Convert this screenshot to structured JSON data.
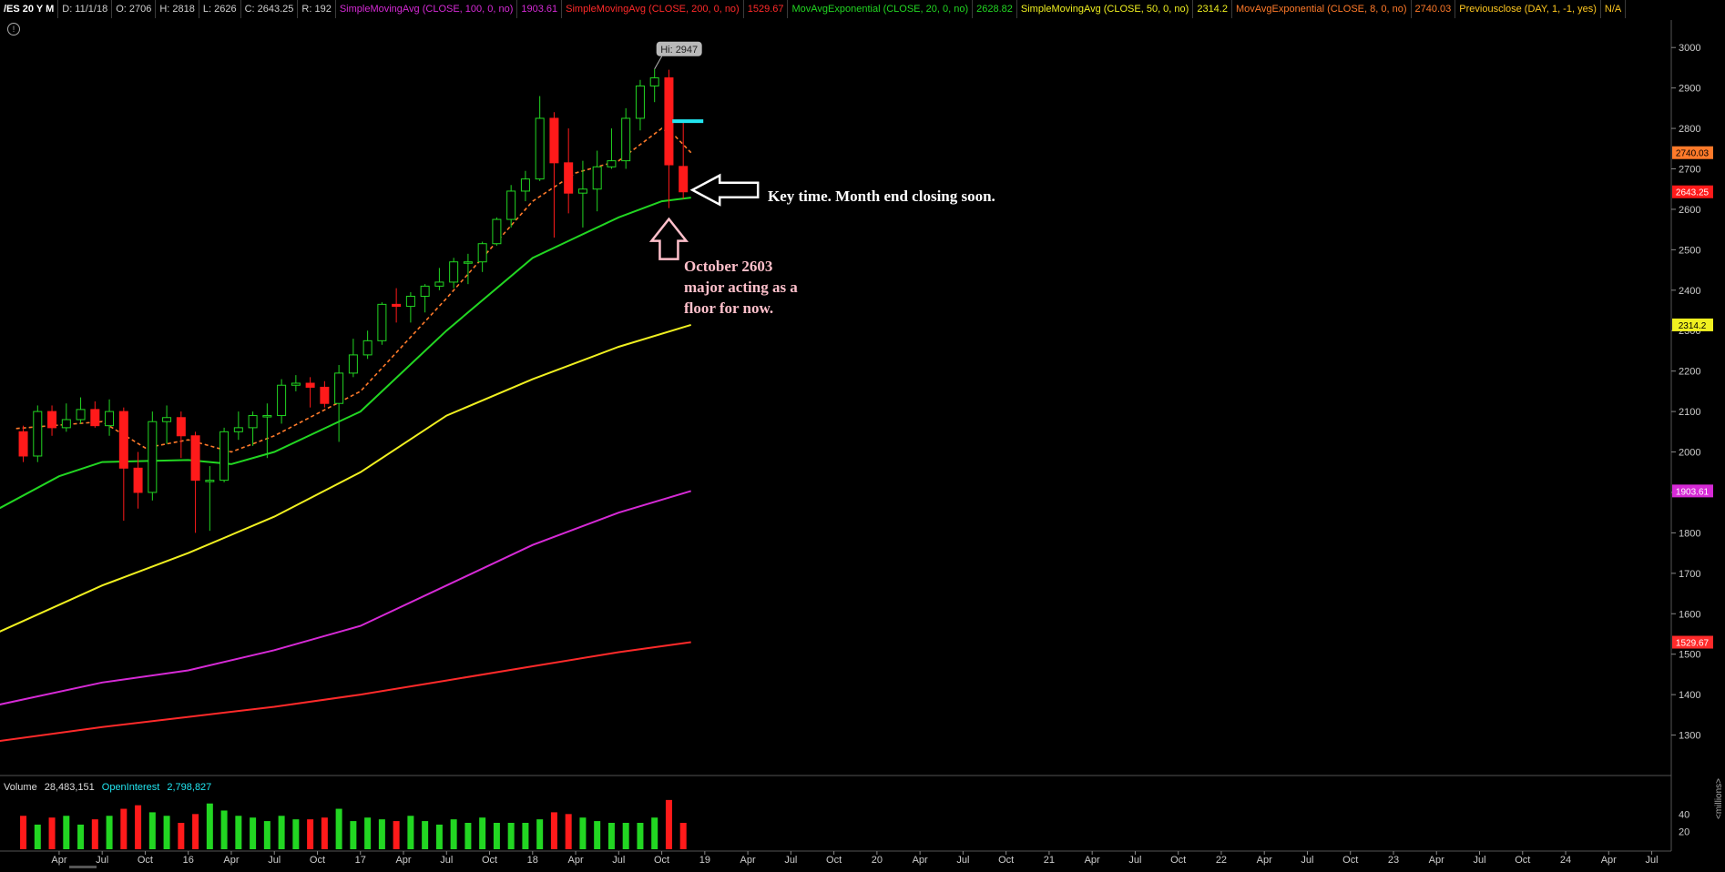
{
  "header": {
    "symbol": "/ES 20 Y M",
    "date": "D: 11/1/18",
    "open": "O: 2706",
    "high": "H: 2818",
    "low": "L: 2626",
    "close": "C: 2643.25",
    "range": "R: 192",
    "studies": [
      {
        "label": "SimpleMovingAvg (CLOSE, 100, 0, no)",
        "value": "1903.61",
        "color": "#d62ad6"
      },
      {
        "label": "SimpleMovingAvg (CLOSE, 200, 0, no)",
        "value": "1529.67",
        "color": "#ff2a2a"
      },
      {
        "label": "MovAvgExponential (CLOSE, 20, 0, no)",
        "value": "2628.82",
        "color": "#22d622"
      },
      {
        "label": "SimpleMovingAvg (CLOSE, 50, 0, no)",
        "value": "2314.2",
        "color": "#f0f020"
      },
      {
        "label": "MovAvgExponential (CLOSE, 8, 0, no)",
        "value": "2740.03",
        "color": "#ff7a2a"
      },
      {
        "label": "Previousclose (DAY, 1, -1, yes)",
        "value": "N/A",
        "color": "#ffc820"
      }
    ]
  },
  "info_icon": "!",
  "volume_header": {
    "volume_label": "Volume",
    "volume_value": "28,483,151",
    "oi_label": "OpenInterest",
    "oi_value": "2,798,827"
  },
  "volume_unit": "<millions>",
  "annotations": {
    "note1": "Key time. Month end closing soon.",
    "note2": "October 2603\nmajor acting as a\nfloor for now."
  },
  "colors": {
    "up": "#22d622",
    "down": "#ff1a1a",
    "background": "#000000",
    "grid": "#2a2a2a",
    "ema8": "#ff7a2a",
    "ema20": "#22d622",
    "sma50": "#f0f020",
    "sma100": "#d62ad6",
    "sma200": "#ff2a2a",
    "cyan_marker": "#22e5f0"
  },
  "chart_data": {
    "type": "candlestick",
    "ylim": [
      1200,
      3050
    ],
    "y_ticks": [
      1300,
      1400,
      1500,
      1600,
      1700,
      1800,
      1900,
      2000,
      2100,
      2200,
      2300,
      2400,
      2500,
      2600,
      2700,
      2800,
      2900,
      3000
    ],
    "x_range": [
      "2014-12",
      "2024-07"
    ],
    "x_ticks": [
      {
        "date": "2015-04",
        "label": "Apr"
      },
      {
        "date": "2015-07",
        "label": "Jul"
      },
      {
        "date": "2015-10",
        "label": "Oct"
      },
      {
        "date": "2016-01",
        "label": "16"
      },
      {
        "date": "2016-04",
        "label": "Apr"
      },
      {
        "date": "2016-07",
        "label": "Jul"
      },
      {
        "date": "2016-10",
        "label": "Oct"
      },
      {
        "date": "2017-01",
        "label": "17"
      },
      {
        "date": "2017-04",
        "label": "Apr"
      },
      {
        "date": "2017-07",
        "label": "Jul"
      },
      {
        "date": "2017-10",
        "label": "Oct"
      },
      {
        "date": "2018-01",
        "label": "18"
      },
      {
        "date": "2018-04",
        "label": "Apr"
      },
      {
        "date": "2018-07",
        "label": "Jul"
      },
      {
        "date": "2018-10",
        "label": "Oct"
      },
      {
        "date": "2019-01",
        "label": "19"
      },
      {
        "date": "2019-04",
        "label": "Apr"
      },
      {
        "date": "2019-07",
        "label": "Jul"
      },
      {
        "date": "2019-10",
        "label": "Oct"
      },
      {
        "date": "2020-01",
        "label": "20"
      },
      {
        "date": "2020-04",
        "label": "Apr"
      },
      {
        "date": "2020-07",
        "label": "Jul"
      },
      {
        "date": "2020-10",
        "label": "Oct"
      },
      {
        "date": "2021-01",
        "label": "21"
      },
      {
        "date": "2021-04",
        "label": "Apr"
      },
      {
        "date": "2021-07",
        "label": "Jul"
      },
      {
        "date": "2021-10",
        "label": "Oct"
      },
      {
        "date": "2022-01",
        "label": "22"
      },
      {
        "date": "2022-04",
        "label": "Apr"
      },
      {
        "date": "2022-07",
        "label": "Jul"
      },
      {
        "date": "2022-10",
        "label": "Oct"
      },
      {
        "date": "2023-01",
        "label": "23"
      },
      {
        "date": "2023-04",
        "label": "Apr"
      },
      {
        "date": "2023-07",
        "label": "Jul"
      },
      {
        "date": "2023-10",
        "label": "Oct"
      },
      {
        "date": "2024-01",
        "label": "24"
      },
      {
        "date": "2024-04",
        "label": "Apr"
      },
      {
        "date": "2024-07",
        "label": "Jul"
      }
    ],
    "candles": [
      {
        "date": "2015-01",
        "o": 2050,
        "h": 2065,
        "l": 1975,
        "c": 1990
      },
      {
        "date": "2015-02",
        "o": 1990,
        "h": 2115,
        "l": 1975,
        "c": 2100
      },
      {
        "date": "2015-03",
        "o": 2100,
        "h": 2115,
        "l": 2040,
        "c": 2060
      },
      {
        "date": "2015-04",
        "o": 2060,
        "h": 2120,
        "l": 2050,
        "c": 2080
      },
      {
        "date": "2015-05",
        "o": 2080,
        "h": 2135,
        "l": 2070,
        "c": 2105
      },
      {
        "date": "2015-06",
        "o": 2105,
        "h": 2125,
        "l": 2060,
        "c": 2065
      },
      {
        "date": "2015-07",
        "o": 2065,
        "h": 2130,
        "l": 2040,
        "c": 2100
      },
      {
        "date": "2015-08",
        "o": 2100,
        "h": 2110,
        "l": 1830,
        "c": 1960
      },
      {
        "date": "2015-09",
        "o": 1960,
        "h": 2000,
        "l": 1860,
        "c": 1900
      },
      {
        "date": "2015-10",
        "o": 1900,
        "h": 2100,
        "l": 1880,
        "c": 2075
      },
      {
        "date": "2015-11",
        "o": 2075,
        "h": 2115,
        "l": 2020,
        "c": 2085
      },
      {
        "date": "2015-12",
        "o": 2085,
        "h": 2100,
        "l": 1985,
        "c": 2040
      },
      {
        "date": "2016-01",
        "o": 2040,
        "h": 2050,
        "l": 1800,
        "c": 1930
      },
      {
        "date": "2016-02",
        "o": 1930,
        "h": 1965,
        "l": 1805,
        "c": 1930
      },
      {
        "date": "2016-03",
        "o": 1930,
        "h": 2060,
        "l": 1925,
        "c": 2050
      },
      {
        "date": "2016-04",
        "o": 2050,
        "h": 2100,
        "l": 2030,
        "c": 2060
      },
      {
        "date": "2016-05",
        "o": 2060,
        "h": 2100,
        "l": 2015,
        "c": 2090
      },
      {
        "date": "2016-06",
        "o": 2090,
        "h": 2120,
        "l": 1985,
        "c": 2090
      },
      {
        "date": "2016-07",
        "o": 2090,
        "h": 2180,
        "l": 2070,
        "c": 2165
      },
      {
        "date": "2016-08",
        "o": 2165,
        "h": 2190,
        "l": 2150,
        "c": 2170
      },
      {
        "date": "2016-09",
        "o": 2170,
        "h": 2185,
        "l": 2110,
        "c": 2160
      },
      {
        "date": "2016-10",
        "o": 2160,
        "h": 2175,
        "l": 2110,
        "c": 2120
      },
      {
        "date": "2016-11",
        "o": 2120,
        "h": 2215,
        "l": 2025,
        "c": 2195
      },
      {
        "date": "2016-12",
        "o": 2195,
        "h": 2280,
        "l": 2185,
        "c": 2240
      },
      {
        "date": "2017-01",
        "o": 2240,
        "h": 2300,
        "l": 2230,
        "c": 2275
      },
      {
        "date": "2017-02",
        "o": 2275,
        "h": 2370,
        "l": 2265,
        "c": 2365
      },
      {
        "date": "2017-03",
        "o": 2365,
        "h": 2405,
        "l": 2320,
        "c": 2360
      },
      {
        "date": "2017-04",
        "o": 2360,
        "h": 2395,
        "l": 2320,
        "c": 2385
      },
      {
        "date": "2017-05",
        "o": 2385,
        "h": 2415,
        "l": 2345,
        "c": 2410
      },
      {
        "date": "2017-06",
        "o": 2410,
        "h": 2455,
        "l": 2400,
        "c": 2420
      },
      {
        "date": "2017-07",
        "o": 2420,
        "h": 2480,
        "l": 2405,
        "c": 2470
      },
      {
        "date": "2017-08",
        "o": 2470,
        "h": 2490,
        "l": 2415,
        "c": 2470
      },
      {
        "date": "2017-09",
        "o": 2470,
        "h": 2520,
        "l": 2445,
        "c": 2515
      },
      {
        "date": "2017-10",
        "o": 2515,
        "h": 2580,
        "l": 2510,
        "c": 2575
      },
      {
        "date": "2017-11",
        "o": 2575,
        "h": 2660,
        "l": 2555,
        "c": 2645
      },
      {
        "date": "2017-12",
        "o": 2645,
        "h": 2695,
        "l": 2620,
        "c": 2675
      },
      {
        "date": "2018-01",
        "o": 2675,
        "h": 2880,
        "l": 2670,
        "c": 2825
      },
      {
        "date": "2018-02",
        "o": 2825,
        "h": 2840,
        "l": 2530,
        "c": 2715
      },
      {
        "date": "2018-03",
        "o": 2715,
        "h": 2800,
        "l": 2590,
        "c": 2640
      },
      {
        "date": "2018-04",
        "o": 2640,
        "h": 2720,
        "l": 2555,
        "c": 2650
      },
      {
        "date": "2018-05",
        "o": 2650,
        "h": 2745,
        "l": 2595,
        "c": 2705
      },
      {
        "date": "2018-06",
        "o": 2705,
        "h": 2800,
        "l": 2700,
        "c": 2720
      },
      {
        "date": "2018-07",
        "o": 2720,
        "h": 2850,
        "l": 2700,
        "c": 2825
      },
      {
        "date": "2018-08",
        "o": 2825,
        "h": 2920,
        "l": 2795,
        "c": 2905
      },
      {
        "date": "2018-09",
        "o": 2905,
        "h": 2947,
        "l": 2865,
        "c": 2925
      },
      {
        "date": "2018-10",
        "o": 2925,
        "h": 2945,
        "l": 2603,
        "c": 2710
      },
      {
        "date": "2018-11",
        "o": 2706,
        "h": 2818,
        "l": 2626,
        "c": 2643.25
      }
    ],
    "hi_label": "Hi: 2947",
    "price_labels": [
      {
        "value": "2740.03",
        "y": 2740.03,
        "color": "#ff7a2a"
      },
      {
        "value": "2643.25",
        "y": 2643.25,
        "color": "#ff1a1a"
      },
      {
        "value": "2314.2",
        "y": 2314.2,
        "color": "#f0f020"
      },
      {
        "value": "1903.61",
        "y": 1903.61,
        "color": "#d62ad6"
      },
      {
        "value": "1529.67",
        "y": 1529.67,
        "color": "#ff2a2a"
      }
    ],
    "cyan_marker_value": 2818,
    "ema8": {
      "style": "dashed",
      "points": [
        [
          2015,
          2058
        ],
        [
          2015.5,
          2075
        ],
        [
          2015.75,
          2010
        ],
        [
          2016,
          2030
        ],
        [
          2016.25,
          2000
        ],
        [
          2016.5,
          2040
        ],
        [
          2017,
          2150
        ],
        [
          2017.5,
          2380
        ],
        [
          2018,
          2620
        ],
        [
          2018.25,
          2690
        ],
        [
          2018.5,
          2720
        ],
        [
          2018.75,
          2800
        ],
        [
          2018.83,
          2780
        ],
        [
          2018.92,
          2740
        ]
      ]
    },
    "ema20": {
      "style": "solid",
      "points": [
        [
          2014.9,
          1860
        ],
        [
          2015.25,
          1940
        ],
        [
          2015.5,
          1975
        ],
        [
          2016,
          1980
        ],
        [
          2016.25,
          1970
        ],
        [
          2016.5,
          2000
        ],
        [
          2017,
          2100
        ],
        [
          2017.5,
          2300
        ],
        [
          2018,
          2480
        ],
        [
          2018.25,
          2530
        ],
        [
          2018.5,
          2580
        ],
        [
          2018.75,
          2620
        ],
        [
          2018.92,
          2628.82
        ]
      ]
    },
    "sma50": {
      "style": "solid",
      "points": [
        [
          2014.9,
          1555
        ],
        [
          2015.5,
          1670
        ],
        [
          2016,
          1750
        ],
        [
          2016.5,
          1840
        ],
        [
          2017,
          1950
        ],
        [
          2017.5,
          2090
        ],
        [
          2018,
          2180
        ],
        [
          2018.5,
          2260
        ],
        [
          2018.92,
          2314.2
        ]
      ]
    },
    "sma100": {
      "style": "solid",
      "points": [
        [
          2014.9,
          1375
        ],
        [
          2015.5,
          1430
        ],
        [
          2016,
          1460
        ],
        [
          2016.5,
          1510
        ],
        [
          2017,
          1570
        ],
        [
          2017.5,
          1670
        ],
        [
          2018,
          1770
        ],
        [
          2018.5,
          1850
        ],
        [
          2018.92,
          1903.61
        ]
      ]
    },
    "sma200": {
      "style": "solid",
      "points": [
        [
          2014.9,
          1285
        ],
        [
          2015.5,
          1320
        ],
        [
          2016,
          1345
        ],
        [
          2016.5,
          1370
        ],
        [
          2017,
          1400
        ],
        [
          2017.5,
          1435
        ],
        [
          2018,
          1470
        ],
        [
          2018.5,
          1505
        ],
        [
          2018.92,
          1529.67
        ]
      ]
    },
    "volume": {
      "ylim": [
        0,
        60
      ],
      "y_ticks": [
        20,
        40
      ],
      "values": [
        38,
        28,
        36,
        38,
        28,
        34,
        38,
        46,
        50,
        42,
        38,
        30,
        40,
        52,
        44,
        38,
        36,
        32,
        38,
        34,
        34,
        36,
        46,
        32,
        36,
        34,
        32,
        38,
        32,
        28,
        34,
        30,
        36,
        30,
        30,
        30,
        34,
        42,
        40,
        36,
        32,
        30,
        30,
        30,
        36,
        56,
        30
      ]
    }
  }
}
